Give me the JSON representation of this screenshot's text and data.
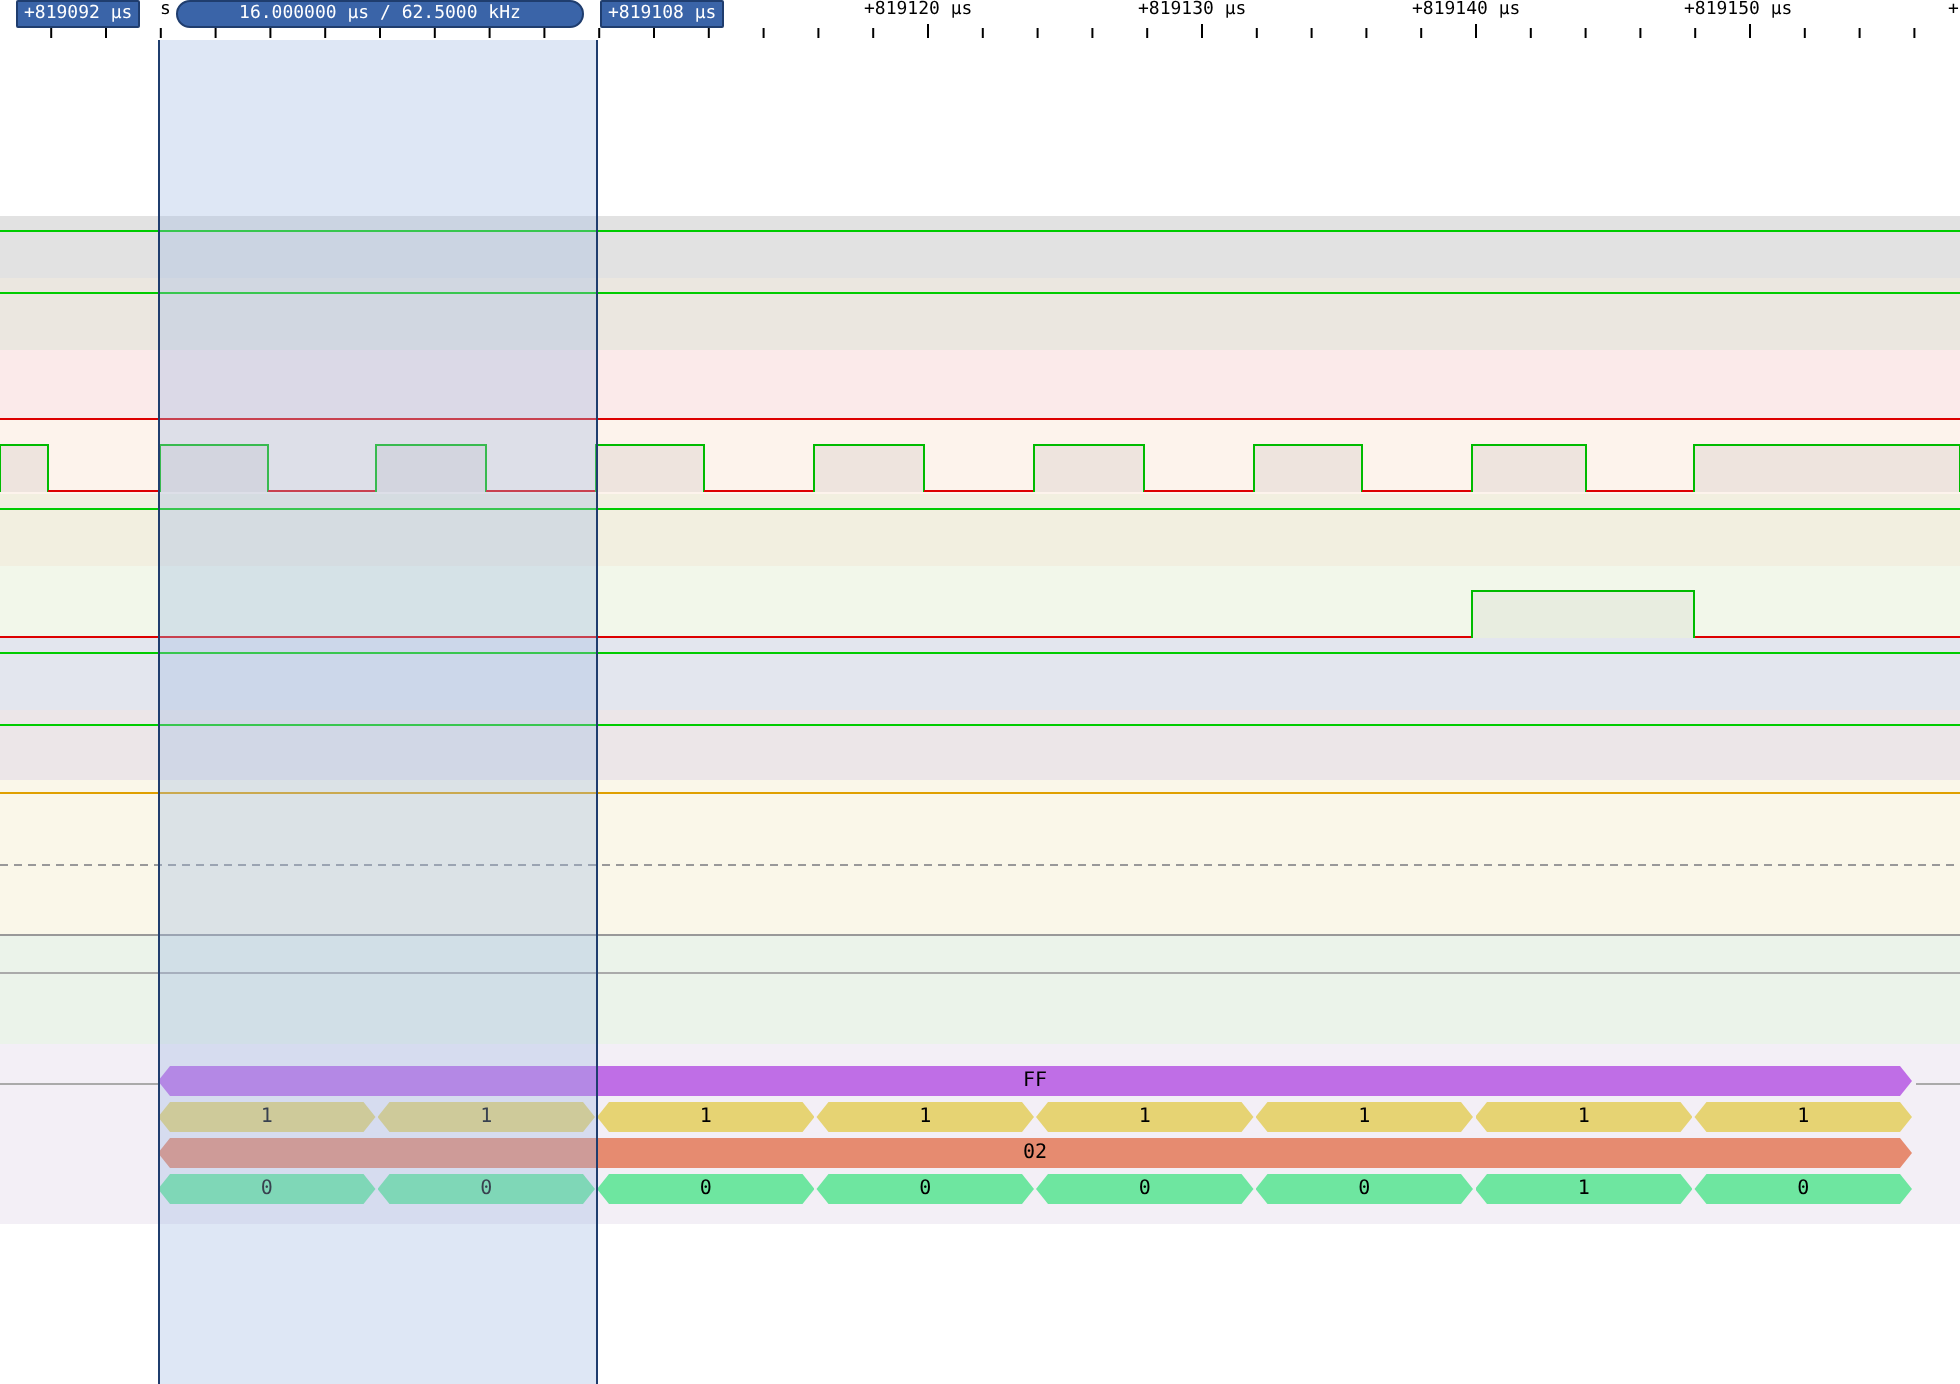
{
  "ruler": {
    "labels": [
      {
        "text": "s"
      },
      {
        "text": "+819120 µs"
      },
      {
        "text": "+819130 µs"
      },
      {
        "text": "+819140 µs"
      },
      {
        "text": "+819150 µs"
      },
      {
        "text": "+"
      }
    ]
  },
  "cursors": {
    "left": "+819092 µs",
    "measurement": "16.000000 µs / 62.5000 kHz",
    "right": "+819108 µs"
  },
  "channels": [
    {
      "kind": "high"
    },
    {
      "kind": "high"
    },
    {
      "kind": "low"
    },
    {
      "kind": "clock"
    },
    {
      "kind": "high"
    },
    {
      "kind": "pulse"
    },
    {
      "kind": "high"
    },
    {
      "kind": "high"
    },
    {
      "kind": "analog"
    },
    {
      "kind": "flat"
    }
  ],
  "decoders": [
    {
      "color": "#bf6ee6",
      "segments": [
        {
          "value": "FF"
        }
      ]
    },
    {
      "color": "#e6d373",
      "segments": [
        {
          "value": "1"
        },
        {
          "value": "1"
        },
        {
          "value": "1"
        },
        {
          "value": "1"
        },
        {
          "value": "1"
        },
        {
          "value": "1"
        },
        {
          "value": "1"
        },
        {
          "value": "1"
        }
      ]
    },
    {
      "color": "#e68b70",
      "segments": [
        {
          "value": "02"
        }
      ]
    },
    {
      "color": "#6ee6a0",
      "segments": [
        {
          "value": "0"
        },
        {
          "value": "0"
        },
        {
          "value": "0"
        },
        {
          "value": "0"
        },
        {
          "value": "0"
        },
        {
          "value": "0"
        },
        {
          "value": "1"
        },
        {
          "value": "0"
        }
      ]
    }
  ]
}
